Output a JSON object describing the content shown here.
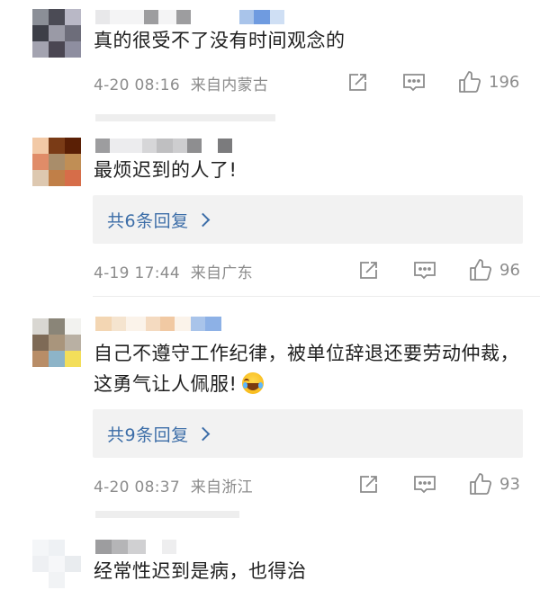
{
  "comments": [
    {
      "text": "真的很受不了没有时间观念的",
      "time": "4-20 08:16",
      "location": "来自内蒙古",
      "likes": "196",
      "reply_label": "",
      "icons": [
        "share-icon",
        "comment-icon",
        "like-icon"
      ]
    },
    {
      "text": "最烦迟到的人了!",
      "time": "4-19 17:44",
      "location": "来自广东",
      "likes": "96",
      "reply_label": "共6条回复"
    },
    {
      "text": "自己不遵守工作纪律，被单位辞退还要劳动仲裁，这勇气让人佩服!",
      "emoji": "laughing-tears-emoji",
      "time": "4-20 08:37",
      "location": "来自浙江",
      "likes": "93",
      "reply_label": "共9条回复"
    },
    {
      "text": "经常性迟到是病，也得治"
    }
  ],
  "colors": {
    "link": "#3d6ea8",
    "meta": "#8c8c8c",
    "reply_bg": "#f2f2f2"
  }
}
